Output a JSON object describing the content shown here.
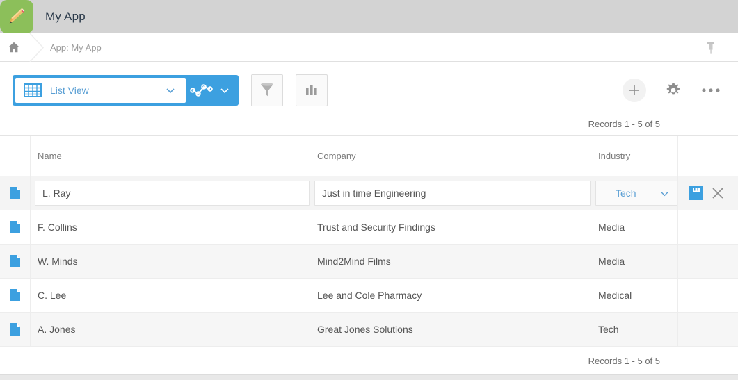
{
  "header": {
    "app_title": "My App",
    "app_icon": "pencil-icon",
    "bg_color": "#d3d3d3",
    "icon_bg_color": "#8cbf5a"
  },
  "breadcrumb": {
    "home_icon": "home-icon",
    "text": "App: My App",
    "pin_icon": "pin-icon"
  },
  "toolbar": {
    "view_select": {
      "label": "List View",
      "icon": "grid-icon",
      "chevron": "chevron-down-icon"
    },
    "chart_toggle": {
      "icon": "line-chart-icon",
      "chevron": "chevron-down-icon"
    },
    "filter_button": {
      "icon": "funnel-icon"
    },
    "report_button": {
      "icon": "bar-chart-icon"
    },
    "add_button": {
      "icon": "plus-icon"
    },
    "settings_button": {
      "icon": "gear-icon"
    },
    "more_button": {
      "icon": "ellipsis-icon"
    },
    "accent_color": "#3ca0e0"
  },
  "records": {
    "top_label": "Records 1 - 5 of 5",
    "bottom_label": "Records 1 - 5 of 5"
  },
  "table": {
    "columns": [
      "",
      "Name",
      "Company",
      "Industry",
      ""
    ],
    "editing_row_index": 0,
    "rows": [
      {
        "icon": "document-icon",
        "name": "L. Ray",
        "company": "Just in time Engineering",
        "industry": "Tech",
        "editing": true,
        "save_icon": "floppy-disk-save-icon",
        "cancel_icon": "close-x-icon"
      },
      {
        "icon": "document-icon",
        "name": "F. Collins",
        "company": "Trust and Security Findings",
        "industry": "Media",
        "editing": false
      },
      {
        "icon": "document-icon",
        "name": "W. Minds",
        "company": "Mind2Mind Films",
        "industry": "Media",
        "editing": false
      },
      {
        "icon": "document-icon",
        "name": "C. Lee",
        "company": "Lee and Cole Pharmacy",
        "industry": "Medical",
        "editing": false
      },
      {
        "icon": "document-icon",
        "name": "A. Jones",
        "company": "Great Jones Solutions",
        "industry": "Tech",
        "editing": false
      }
    ]
  }
}
